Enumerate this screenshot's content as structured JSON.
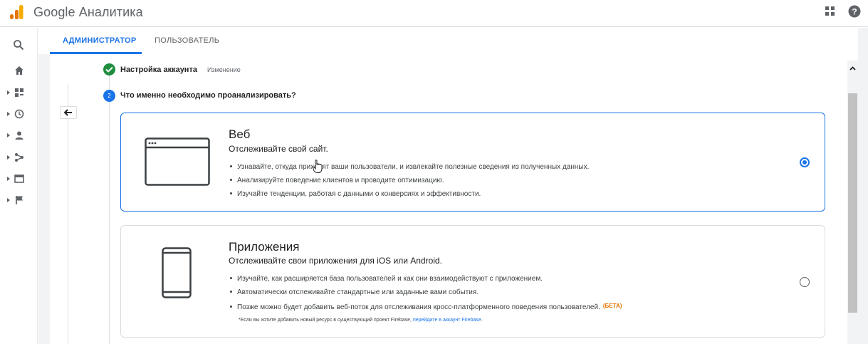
{
  "app": {
    "title": "Google Аналитика",
    "brand_color": "#f9ab00",
    "accent_color": "#1a73e8"
  },
  "header": {
    "apps_icon": "apps-grid-icon",
    "help_icon": "help-circle-icon"
  },
  "leftrail": {
    "items": [
      {
        "icon": "search-icon"
      },
      {
        "icon": "home-icon"
      },
      {
        "icon": "customization-icon"
      },
      {
        "icon": "realtime-clock-icon"
      },
      {
        "icon": "audience-person-icon"
      },
      {
        "icon": "acquisition-icon"
      },
      {
        "icon": "behavior-icon"
      },
      {
        "icon": "conversions-flag-icon"
      }
    ]
  },
  "tabs": [
    {
      "label": "АДМИНИСТРАТОР",
      "active": true
    },
    {
      "label": "ПОЛЬЗОВАТЕЛЬ",
      "active": false
    }
  ],
  "stepper": {
    "step1": {
      "title": "Настройка аккаунта",
      "edit_label": "Изменение",
      "status": "complete"
    },
    "step2": {
      "number": "2",
      "title": "Что именно необходимо проанализировать?"
    }
  },
  "options": {
    "web": {
      "title": "Веб",
      "subtitle": "Отслеживайте свой сайт.",
      "bullets": [
        "Узнавайте, откуда приходят ваши пользователи, и извлекайте полезные сведения из полученных данных.",
        "Анализируйте поведение клиентов и проводите оптимизацию.",
        "Изучайте тенденции, работая с данными о конверсиях и эффективности."
      ],
      "selected": true
    },
    "app": {
      "title": "Приложения",
      "subtitle": "Отслеживайте свои приложения для iOS или Android.",
      "bullets": [
        "Изучайте, как расширяется база пользователей и как они взаимодействуют с приложением.",
        "Автоматически отслеживайте стандартные или заданные вами события.",
        "Позже можно будет добавить веб-поток для отслеживания кросс-платформенного поведения пользователей."
      ],
      "beta_label": "(БЕТА)",
      "footnote_text": "*Если вы хотите добавить новый ресурс в существующий проект Firebase,",
      "footnote_link": "перейдите в аккаунт Firebase",
      "footnote_end": ".",
      "selected": false
    }
  }
}
